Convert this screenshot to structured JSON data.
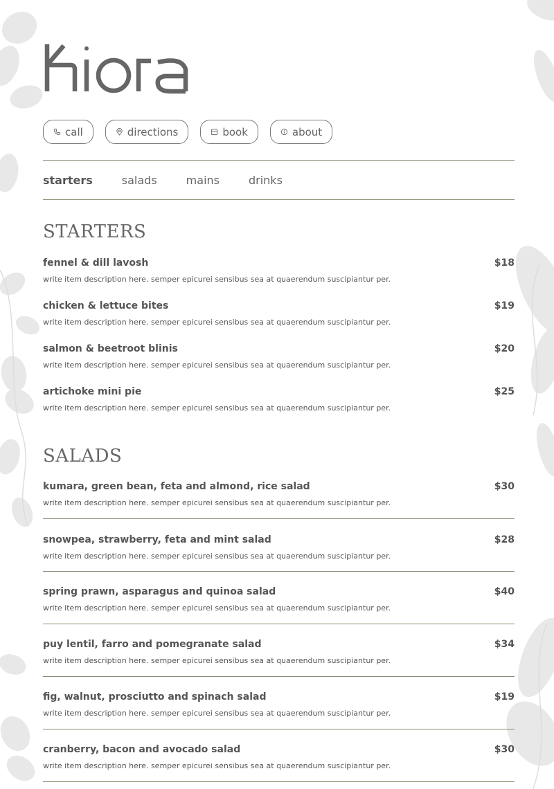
{
  "brand": {
    "name": "kiora"
  },
  "actions": [
    {
      "label": "call",
      "icon": "phone-icon"
    },
    {
      "label": "directions",
      "icon": "location-pin-icon"
    },
    {
      "label": "book",
      "icon": "calendar-icon"
    },
    {
      "label": "about",
      "icon": "info-icon"
    }
  ],
  "nav": {
    "tabs": [
      {
        "label": "starters",
        "active": true
      },
      {
        "label": "salads",
        "active": false
      },
      {
        "label": "mains",
        "active": false
      },
      {
        "label": "drinks",
        "active": false
      }
    ]
  },
  "starters": {
    "title": "STARTERS",
    "items": [
      {
        "name": "fennel & dill lavosh",
        "price": "$18",
        "desc": "write item description here. semper epicurei sensibus sea at quaerendum suscipiantur per."
      },
      {
        "name": "chicken & lettuce bites",
        "price": "$19",
        "desc": "write item description here. semper epicurei sensibus sea at quaerendum suscipiantur per."
      },
      {
        "name": "salmon & beetroot blinis",
        "price": "$20",
        "desc": "write item description here. semper epicurei sensibus sea at quaerendum suscipiantur per."
      },
      {
        "name": "artichoke mini pie",
        "price": "$25",
        "desc": "write item description here. semper epicurei sensibus sea at quaerendum suscipiantur per."
      }
    ]
  },
  "salads": {
    "title": "SALADS",
    "items": [
      {
        "name": "kumara, green bean, feta and almond, rice salad",
        "price": "$30",
        "desc": "write item description here. semper epicurei sensibus sea at quaerendum suscipiantur per."
      },
      {
        "name": "snowpea, strawberry, feta and mint salad",
        "price": "$28",
        "desc": "write item description here. semper epicurei sensibus sea at quaerendum suscipiantur per."
      },
      {
        "name": "spring prawn, asparagus and quinoa salad",
        "price": "$40",
        "desc": "write item description here. semper epicurei sensibus sea at quaerendum suscipiantur per."
      },
      {
        "name": "puy lentil, farro and pomegranate salad",
        "price": "$34",
        "desc": "write item description here. semper epicurei sensibus sea at quaerendum suscipiantur per."
      },
      {
        "name": "fig, walnut, prosciutto and spinach salad",
        "price": "$19",
        "desc": "write item description here. semper epicurei sensibus sea at quaerendum suscipiantur per."
      },
      {
        "name": "cranberry, bacon and avocado salad",
        "price": "$30",
        "desc": "write item description here. semper epicurei sensibus sea at quaerendum suscipiantur per."
      }
    ]
  },
  "colors": {
    "text": "#555555",
    "divider": "#8c8a6e",
    "leaf": "#e4e4e4"
  }
}
